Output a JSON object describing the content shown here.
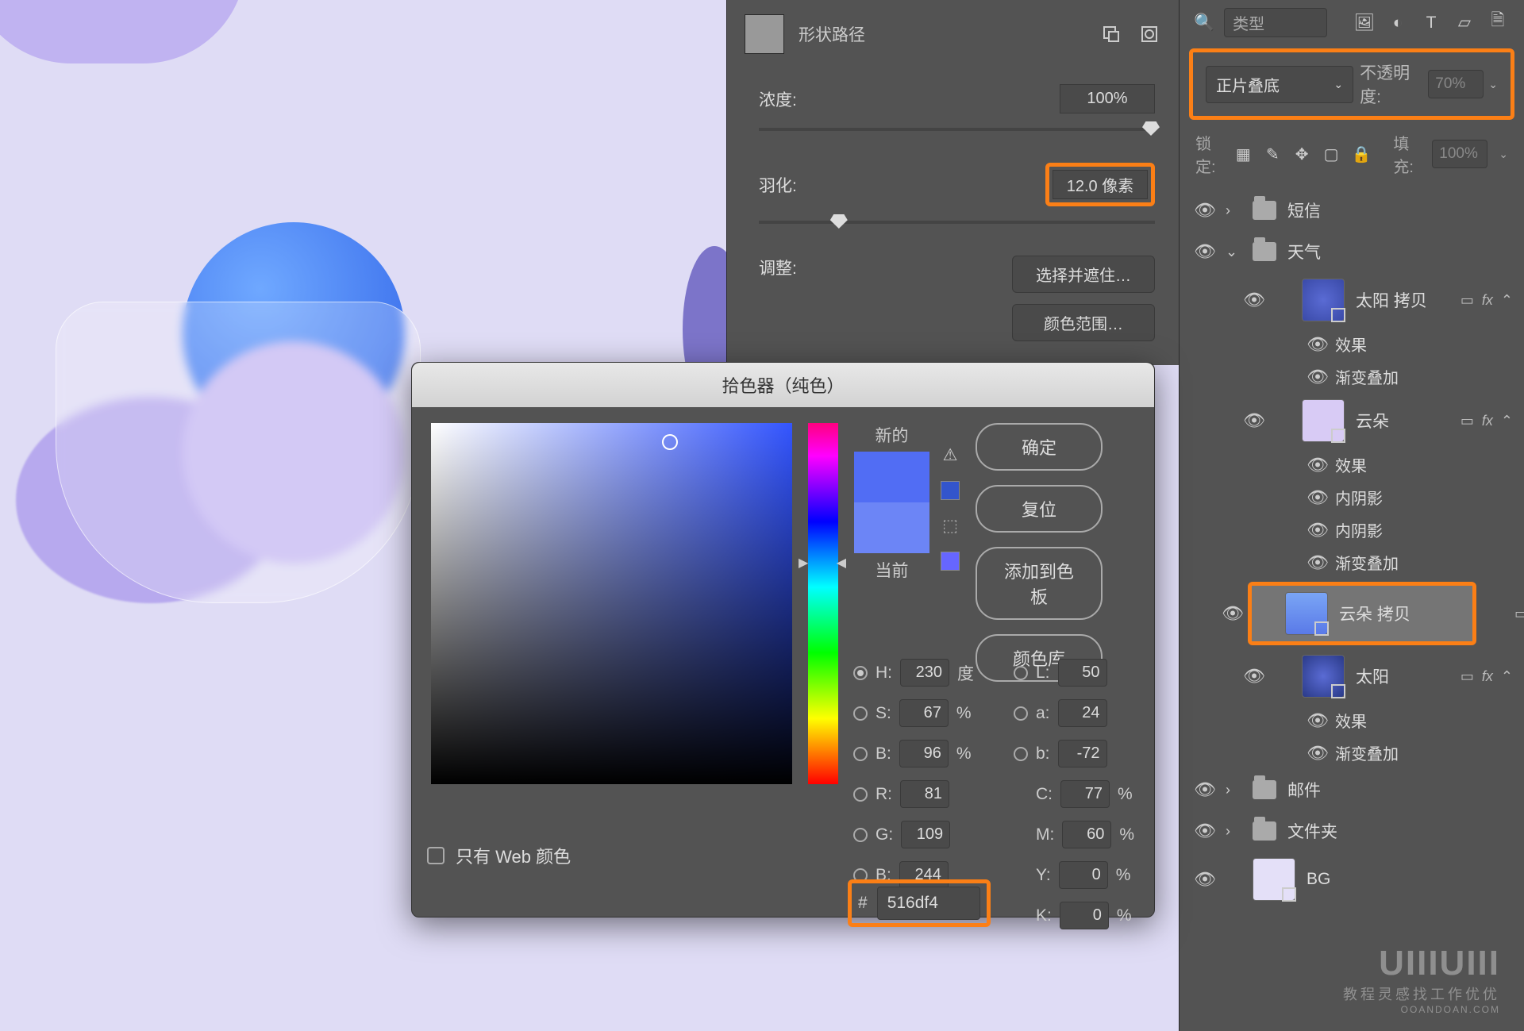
{
  "masks": {
    "title": "形状路径",
    "density_label": "浓度:",
    "density_value": "100%",
    "feather_label": "羽化:",
    "feather_value": "12.0 像素",
    "adjust_label": "调整:",
    "select_and_mask": "选择并遮住…",
    "color_range": "颜色范围…"
  },
  "layers": {
    "filter_placeholder": "类型",
    "blend_mode": "正片叠底",
    "opacity_label": "不透明度:",
    "opacity_value": "70%",
    "lock_label": "锁定:",
    "fill_label": "填充:",
    "fill_value": "100%",
    "items": [
      {
        "name": "短信",
        "type": "folder"
      },
      {
        "name": "天气",
        "type": "folder",
        "expanded": true
      },
      {
        "name": "太阳 拷贝",
        "fx": true,
        "effects": [
          "效果",
          "渐变叠加"
        ]
      },
      {
        "name": "云朵",
        "fx": true,
        "effects": [
          "效果",
          "内阴影",
          "内阴影",
          "渐变叠加"
        ]
      },
      {
        "name": "云朵 拷贝",
        "selected": true
      },
      {
        "name": "太阳",
        "fx": true,
        "effects": [
          "效果",
          "渐变叠加"
        ]
      },
      {
        "name": "邮件",
        "type": "folder"
      },
      {
        "name": "文件夹",
        "type": "folder"
      },
      {
        "name": "BG"
      }
    ],
    "fx_label": "fx"
  },
  "picker": {
    "title": "拾色器（纯色）",
    "new_label": "新的",
    "current_label": "当前",
    "buttons": {
      "ok": "确定",
      "reset": "复位",
      "add_swatch": "添加到色板",
      "libraries": "颜色库"
    },
    "web_only": "只有 Web 颜色",
    "values": {
      "H": "230",
      "H_unit": "度",
      "S": "67",
      "S_unit": "%",
      "B": "96",
      "B_unit": "%",
      "R": "81",
      "G": "109",
      "Bb": "244",
      "L": "50",
      "a": "24",
      "b2": "-72",
      "C": "77",
      "M": "60",
      "Y": "0",
      "K": "0",
      "hex": "516df4"
    },
    "labels": {
      "H": "H:",
      "S": "S:",
      "B": "B:",
      "R": "R:",
      "G": "G:",
      "Bb": "B:",
      "L": "L:",
      "a": "a:",
      "b2": "b:",
      "C": "C:",
      "M": "M:",
      "Y": "Y:",
      "K": "K:",
      "pct": "%",
      "hash": "#"
    }
  },
  "watermark": {
    "brand": "UIIIUIII",
    "tagline": "教程灵感找工作优优",
    "sub": "OOANDOAN.COM"
  }
}
